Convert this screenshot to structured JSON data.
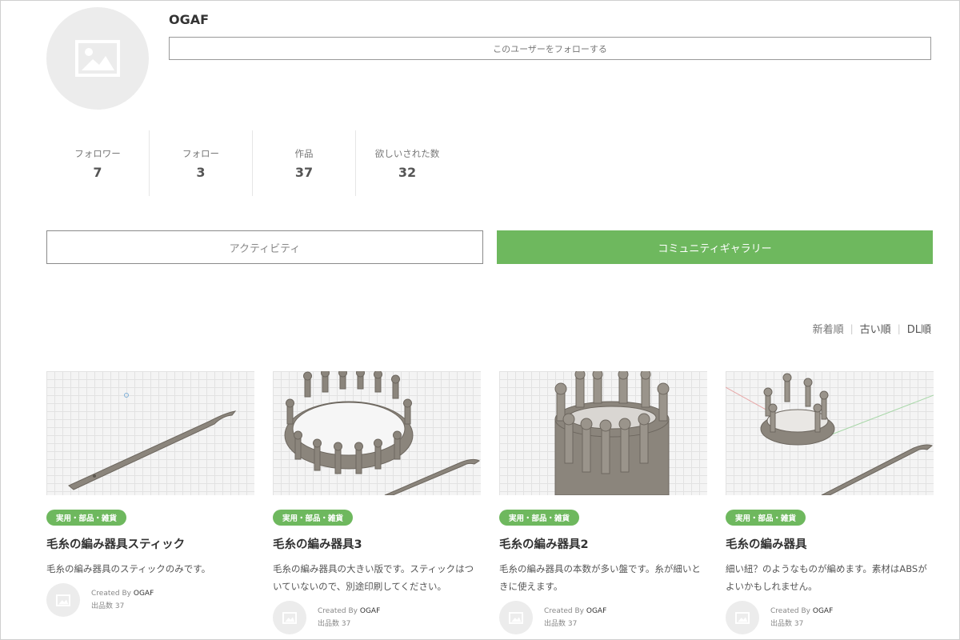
{
  "profile": {
    "username": "OGAF",
    "follow_label": "このユーザーをフォローする",
    "avatar_icon": "image-placeholder-icon"
  },
  "stats": [
    {
      "label": "フォロワー",
      "value": "7"
    },
    {
      "label": "フォロー",
      "value": "3"
    },
    {
      "label": "作品",
      "value": "37"
    },
    {
      "label": "欲しいされた数",
      "value": "32"
    }
  ],
  "tabs": {
    "activity": "アクティビティ",
    "gallery": "コミュニティギャラリー",
    "active": "gallery"
  },
  "sort": {
    "options": [
      "新着順",
      "古い順",
      "DL順"
    ]
  },
  "cards": [
    {
      "tag": "実用・部品・雑貨",
      "title": "毛糸の編み器具スティック",
      "desc": "毛糸の編み器具のスティックのみです。",
      "created_by_label": "Created By",
      "creator": "OGAF",
      "count_label": "出品数 37"
    },
    {
      "tag": "実用・部品・雑貨",
      "title": "毛糸の編み器具3",
      "desc": "毛糸の編み器具の大きい版です。スティックはついていないので、別途印刷してください。",
      "created_by_label": "Created By",
      "creator": "OGAF",
      "count_label": "出品数 37"
    },
    {
      "tag": "実用・部品・雑貨",
      "title": "毛糸の編み器具2",
      "desc": "毛糸の編み器具の本数が多い盤です。糸が細いときに使えます。",
      "created_by_label": "Created By",
      "creator": "OGAF",
      "count_label": "出品数 37"
    },
    {
      "tag": "実用・部品・雑貨",
      "title": "毛糸の編み器具",
      "desc": "細い紐？のようなものが編めます。素材はABSがよいかもしれません。",
      "created_by_label": "Created By",
      "creator": "OGAF",
      "count_label": "出品数 37"
    }
  ],
  "colors": {
    "accent": "#6eb85e",
    "model": "#8b857c"
  }
}
